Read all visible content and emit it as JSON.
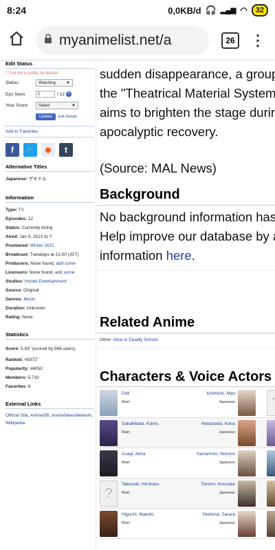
{
  "status_bar": {
    "time": "8:24",
    "net_speed": "0,0KB/d",
    "battery": "32"
  },
  "browser": {
    "url": "myanimelist.net/a",
    "tab_count": "26"
  },
  "sidebar": {
    "edit_status_title": "Edit Status",
    "public_note": "* Your list is public by default.",
    "status_label": "Status:",
    "status_value": "Watching",
    "eps_label": "Eps Seen:",
    "eps_value": "1",
    "eps_total": "/ 12",
    "score_label": "Your Score:",
    "score_value": "Select",
    "update_button": "Update",
    "edit_details": "Edit Details",
    "add_favorites": "Add to Favorites",
    "alt_titles_title": "Alternative Titles",
    "japanese_label": "Japanese:",
    "japanese_value": "ゲキドル",
    "info_title": "Information",
    "type_label": "Type:",
    "type_value": "TV",
    "episodes_label": "Episodes:",
    "episodes_value": "12",
    "status2_label": "Status:",
    "status2_value": "Currently Airing",
    "aired_label": "Aired:",
    "aired_value": "Jan 5, 2021 to ?",
    "premiered_label": "Premiered:",
    "premiered_value": "Winter 2021",
    "broadcast_label": "Broadcast:",
    "broadcast_value": "Tuesdays at 21:00 (JST)",
    "producers_label": "Producers:",
    "producers_value": "None found,",
    "producers_add": "add some",
    "licensors_label": "Licensors:",
    "licensors_value": "None found,",
    "licensors_add": "add some",
    "studios_label": "Studios:",
    "studios_value": "Hoods Entertainment",
    "source_label": "Source:",
    "source_value": "Original",
    "genres_label": "Genres:",
    "genres_value": "Music",
    "duration_label": "Duration:",
    "duration_value": "Unknown",
    "rating_label": "Rating:",
    "rating_value": "None",
    "stats_title": "Statistics",
    "score_label2": "Score:",
    "score_value2": "5.93",
    "score_sup": "1",
    "score_users": "(scored by 566 users)",
    "ranked_label": "Ranked:",
    "ranked_value": "#8372",
    "ranked_sup": "2",
    "popularity_label": "Popularity:",
    "popularity_value": "#6050",
    "members_label": "Members:",
    "members_value": "5,710",
    "favorites_label": "Favorites:",
    "favorites_value": "8",
    "external_title": "External Links",
    "link1": "Official Site",
    "link2": "AnimeDB",
    "link3": "AnimeNewsNetwork",
    "link4": "Wikipedia"
  },
  "main": {
    "lines": [
      "sudden disappearance, a group",
      "the \"Theatrical Material System",
      "aims to brighten the stage durin",
      "apocalyptic recovery."
    ],
    "source": "(Source: MAL News)",
    "background_title": "Background",
    "bg_line1": "No background information has",
    "bg_line2": "Help improve our database by a",
    "bg_line3": "information",
    "bg_here": "here",
    "related_title": "Related Anime",
    "related_label": "Other:",
    "related_link": "Alice in Deadly School,",
    "characters_title": "Characters & Voice Actors",
    "characters": [
      {
        "name": "Doll",
        "role": "Main",
        "va": "Ichimichi, Mao",
        "lang": "Japanese"
      },
      {
        "name": "Sakakibara, Kaoru",
        "role": "Main",
        "va": "Hanazawa, Kana",
        "lang": "Japanese"
      },
      {
        "name": "Asagi, Akira",
        "role": "Main",
        "va": "Yamamoto, Nozomi",
        "lang": "Japanese"
      },
      {
        "name": "Takezaki, Hirokazu",
        "role": "Main",
        "va": "Toriumi, Kousuke",
        "lang": "Japanese"
      },
      {
        "name": "Higuchi, Makoto",
        "role": "Main",
        "va": "Yashima, Sarara",
        "lang": "Japanese"
      }
    ]
  }
}
